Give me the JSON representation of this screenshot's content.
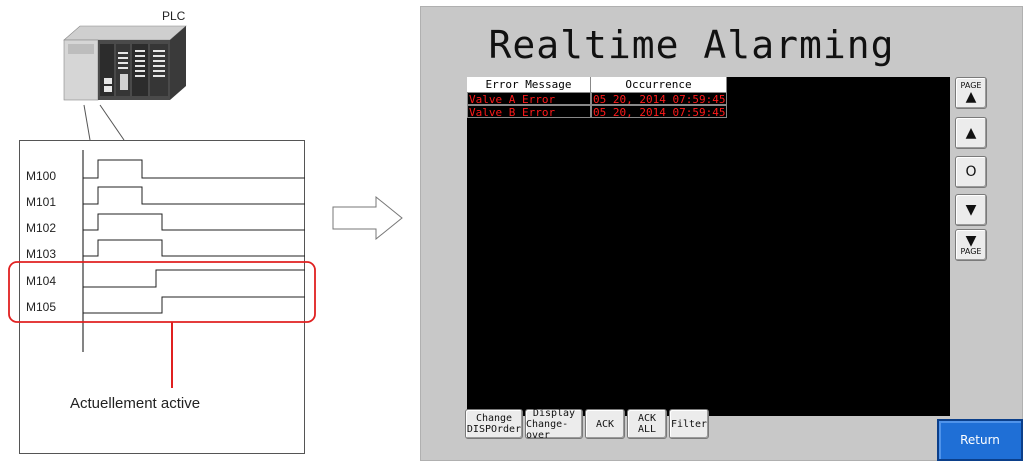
{
  "diagram": {
    "plc_label": "PLC",
    "signals": [
      "M100",
      "M101",
      "M102",
      "M103",
      "M104",
      "M105"
    ],
    "callout": "Actuellement active"
  },
  "hmi": {
    "title": "Realtime Alarming",
    "columns": [
      "Error Message",
      "Occurrence"
    ],
    "rows": [
      {
        "message": "Valve A Error",
        "occurrence": "05 20, 2014 07:59:45"
      },
      {
        "message": "Valve B Error",
        "occurrence": "05 20, 2014 07:59:45"
      }
    ],
    "side_buttons": {
      "page_label": "PAGE",
      "up": "▲",
      "center": "O",
      "down": "▼"
    },
    "bottom_buttons": {
      "change": [
        "Change",
        "DISPOrder"
      ],
      "display": [
        "Display",
        "Change-over"
      ],
      "ack": "ACK",
      "ack_all": [
        "ACK",
        "ALL"
      ],
      "filter": "Filter"
    },
    "return_label": "Return"
  },
  "colors": {
    "alarm_text": "#ff1a1a",
    "return_button": "#1f6fd6",
    "highlight": "#e02020"
  }
}
